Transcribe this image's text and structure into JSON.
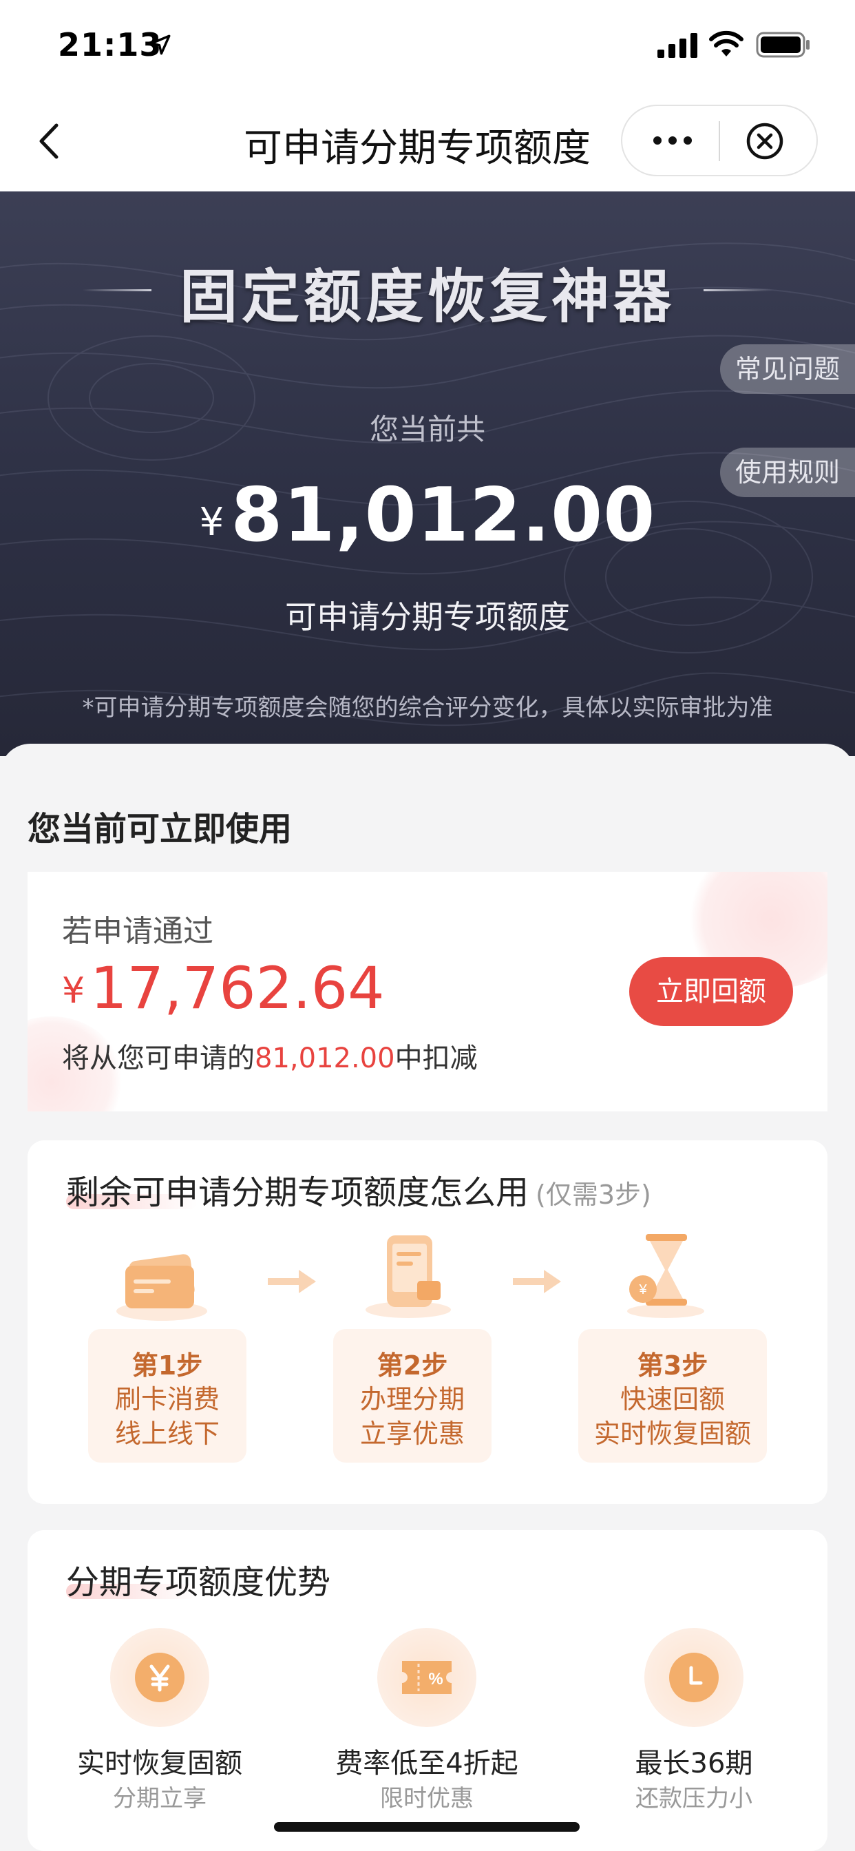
{
  "status_bar": {
    "time": "21:13"
  },
  "nav": {
    "title": "可申请分期专项额度",
    "back_icon": "chevron-left-icon",
    "more_icon": "more-dots-icon",
    "close_icon": "close-circle-icon"
  },
  "hero": {
    "banner_title": "固定额度恢复神器",
    "faq_tab": "常见问题",
    "rules_tab": "使用规则",
    "subtitle": "您当前共",
    "currency": "¥",
    "amount": "81,012.00",
    "caption": "可申请分期专项额度",
    "note": "*可申请分期专项额度会随您的综合评分变化，具体以实际审批为准"
  },
  "immediate": {
    "section_title": "您当前可立即使用",
    "if_pass": "若申请通过",
    "currency": "¥",
    "amount": "17,762.64",
    "deduct_prefix": "将从您可申请的",
    "deduct_amount": "81,012.00",
    "deduct_suffix": "中扣减",
    "button": "立即回额"
  },
  "howto": {
    "title": "剩余可申请分期专项额度怎么用",
    "hint": "(仅需3步)",
    "steps": [
      {
        "icon": "credit-card-icon",
        "heading": "第1步",
        "line1": "刷卡消费",
        "line2": "线上线下"
      },
      {
        "icon": "phone-installment-icon",
        "heading": "第2步",
        "line1": "办理分期",
        "line2": "立享优惠"
      },
      {
        "icon": "hourglass-coin-icon",
        "heading": "第3步",
        "line1": "快速回额",
        "line2": "实时恢复固额"
      }
    ]
  },
  "advantages": {
    "title": "分期专项额度优势",
    "items": [
      {
        "icon": "yen-coin-icon",
        "label": "实时恢复固额",
        "sub": "分期立享"
      },
      {
        "icon": "discount-ticket-icon",
        "label": "费率低至4折起",
        "sub": "限时优惠"
      },
      {
        "icon": "clock-icon",
        "label": "最长36期",
        "sub": "还款压力小"
      }
    ]
  },
  "colors": {
    "accent_red": "#e84b44",
    "hero_bg": "#2d3044",
    "step_text": "#c4682e"
  }
}
